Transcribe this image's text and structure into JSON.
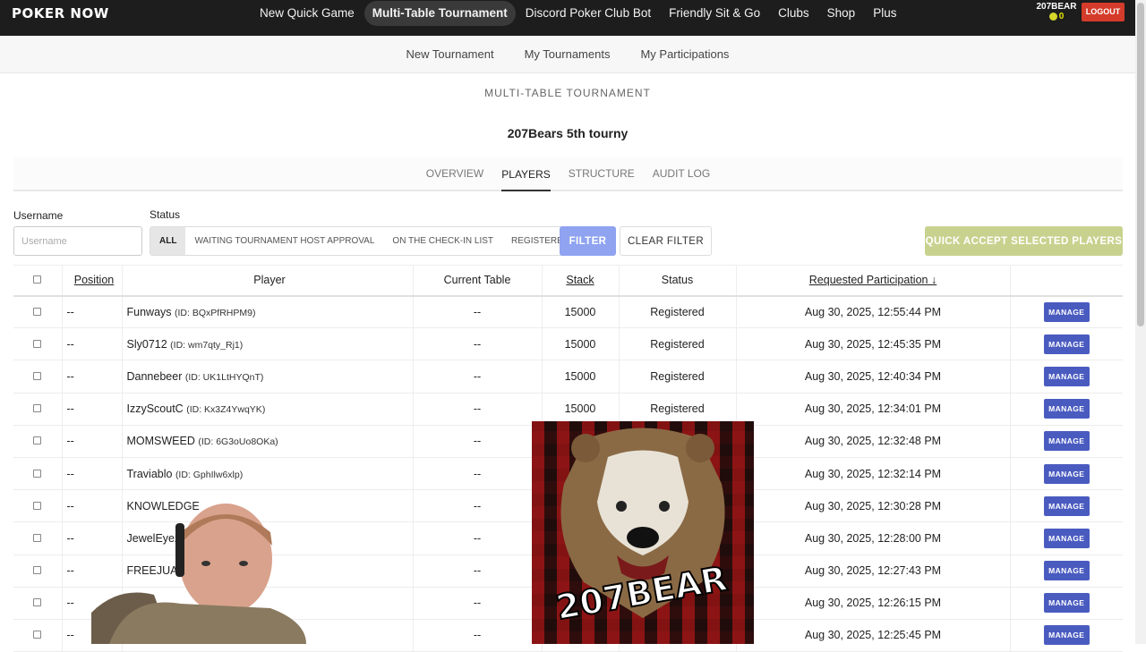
{
  "app": {
    "logo": "POKER NOW"
  },
  "topnav": {
    "items": [
      {
        "label": "New Quick Game"
      },
      {
        "label": "Multi-Table Tournament",
        "active": true
      },
      {
        "label": "Discord Poker Club Bot"
      },
      {
        "label": "Friendly Sit & Go"
      },
      {
        "label": "Clubs"
      },
      {
        "label": "Shop"
      },
      {
        "label": "Plus"
      }
    ],
    "username": "207BEAR",
    "coins": "0",
    "logout": "LOGOUT"
  },
  "subnav": {
    "items": [
      {
        "label": "New Tournament"
      },
      {
        "label": "My Tournaments"
      },
      {
        "label": "My Participations"
      }
    ]
  },
  "page": {
    "section_label": "MULTI-TABLE TOURNAMENT",
    "tournament_name": "207Bears 5th tourny"
  },
  "tabs": [
    {
      "label": "OVERVIEW"
    },
    {
      "label": "PLAYERS",
      "active": true
    },
    {
      "label": "STRUCTURE"
    },
    {
      "label": "AUDIT LOG"
    }
  ],
  "filters": {
    "username_label": "Username",
    "username_placeholder": "Username",
    "status_label": "Status",
    "status_options": [
      "ALL",
      "WAITING TOURNAMENT HOST APPROVAL",
      "ON THE CHECK-IN LIST",
      "REGISTERED"
    ],
    "filter_button": "FILTER",
    "clear_button": "CLEAR FILTER",
    "quick_accept_button": "QUICK ACCEPT SELECTED PLAYERS"
  },
  "table": {
    "headers": {
      "position": "Position",
      "player": "Player",
      "current_table": "Current Table",
      "stack": "Stack",
      "status": "Status",
      "requested": "Requested Participation ↓"
    },
    "manage_label": "MANAGE",
    "rows": [
      {
        "position": "--",
        "name": "Funways",
        "id": "(ID: BQxPfRHPM9)",
        "table": "--",
        "stack": "15000",
        "status": "Registered",
        "requested": "Aug 30, 2025, 12:55:44 PM"
      },
      {
        "position": "--",
        "name": "Sly0712",
        "id": "(ID: wm7qty_Rj1)",
        "table": "--",
        "stack": "15000",
        "status": "Registered",
        "requested": "Aug 30, 2025, 12:45:35 PM"
      },
      {
        "position": "--",
        "name": "Dannebeer",
        "id": "(ID: UK1LtHYQnT)",
        "table": "--",
        "stack": "15000",
        "status": "Registered",
        "requested": "Aug 30, 2025, 12:40:34 PM"
      },
      {
        "position": "--",
        "name": "IzzyScoutC",
        "id": "(ID: Kx3Z4YwqYK)",
        "table": "--",
        "stack": "15000",
        "status": "Registered",
        "requested": "Aug 30, 2025, 12:34:01 PM"
      },
      {
        "position": "--",
        "name": "MOMSWEED",
        "id": "(ID: 6G3oUo8OKa)",
        "table": "--",
        "stack": "",
        "status": "",
        "requested": "Aug 30, 2025, 12:32:48 PM"
      },
      {
        "position": "--",
        "name": "Traviablo",
        "id": "(ID: GphIlw6xlp)",
        "table": "--",
        "stack": "",
        "status": "",
        "requested": "Aug 30, 2025, 12:32:14 PM"
      },
      {
        "position": "--",
        "name": "KNOWLEDGE",
        "id": "",
        "table": "--",
        "stack": "",
        "status": "",
        "requested": "Aug 30, 2025, 12:30:28 PM"
      },
      {
        "position": "--",
        "name": "JewelEyez",
        "id": "",
        "table": "--",
        "stack": "",
        "status": "",
        "requested": "Aug 30, 2025, 12:28:00 PM"
      },
      {
        "position": "--",
        "name": "FREEJUAN",
        "id": "",
        "table": "--",
        "stack": "",
        "status": "",
        "requested": "Aug 30, 2025, 12:27:43 PM"
      },
      {
        "position": "--",
        "name": "",
        "id": "",
        "table": "--",
        "stack": "",
        "status": "",
        "requested": "Aug 30, 2025, 12:26:15 PM"
      },
      {
        "position": "--",
        "name": "",
        "id": "",
        "table": "--",
        "stack": "",
        "status": "",
        "requested": "Aug 30, 2025, 12:25:45 PM"
      }
    ]
  },
  "overlay": {
    "logo_text": "207BEAR"
  }
}
